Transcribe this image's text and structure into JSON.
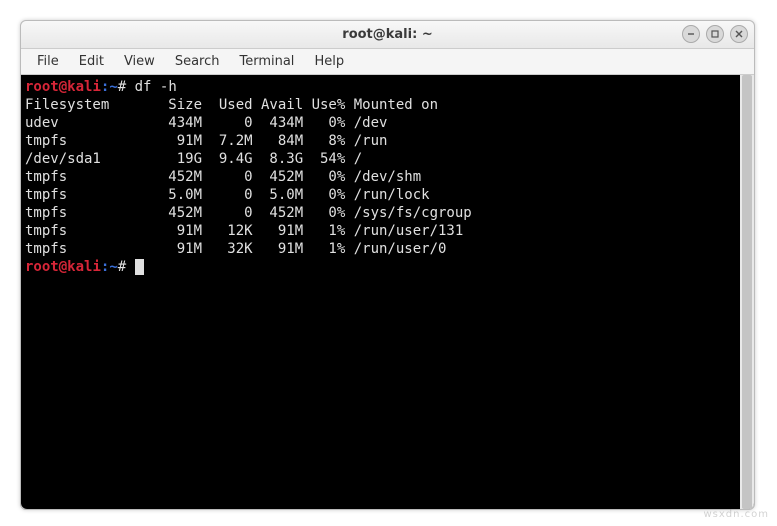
{
  "window": {
    "title": "root@kali: ~"
  },
  "menubar": [
    "File",
    "Edit",
    "View",
    "Search",
    "Terminal",
    "Help"
  ],
  "prompt": {
    "user": "root",
    "sep": "@",
    "host": "kali",
    "colon": ":",
    "path": "~",
    "hash": "#"
  },
  "command": "df -h",
  "header": {
    "fs": "Filesystem",
    "size": "Size",
    "used": "Used",
    "avail": "Avail",
    "usep": "Use%",
    "mount": "Mounted on"
  },
  "rows": [
    {
      "fs": "udev",
      "size": "434M",
      "used": "0",
      "avail": "434M",
      "usep": "0%",
      "mount": "/dev"
    },
    {
      "fs": "tmpfs",
      "size": "91M",
      "used": "7.2M",
      "avail": "84M",
      "usep": "8%",
      "mount": "/run"
    },
    {
      "fs": "/dev/sda1",
      "size": "19G",
      "used": "9.4G",
      "avail": "8.3G",
      "usep": "54%",
      "mount": "/"
    },
    {
      "fs": "tmpfs",
      "size": "452M",
      "used": "0",
      "avail": "452M",
      "usep": "0%",
      "mount": "/dev/shm"
    },
    {
      "fs": "tmpfs",
      "size": "5.0M",
      "used": "0",
      "avail": "5.0M",
      "usep": "0%",
      "mount": "/run/lock"
    },
    {
      "fs": "tmpfs",
      "size": "452M",
      "used": "0",
      "avail": "452M",
      "usep": "0%",
      "mount": "/sys/fs/cgroup"
    },
    {
      "fs": "tmpfs",
      "size": "91M",
      "used": "12K",
      "avail": "91M",
      "usep": "1%",
      "mount": "/run/user/131"
    },
    {
      "fs": "tmpfs",
      "size": "91M",
      "used": "32K",
      "avail": "91M",
      "usep": "1%",
      "mount": "/run/user/0"
    }
  ],
  "watermark": "wsxdn.com"
}
